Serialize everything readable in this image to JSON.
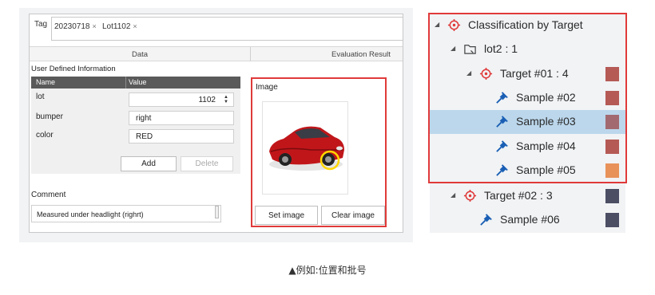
{
  "editor": {
    "tag_label": "Tag",
    "tags": [
      {
        "label": "20230718"
      },
      {
        "label": "Lot1102"
      }
    ],
    "remove_glyph": "×",
    "columns": {
      "data": "Data",
      "evaluation": "Evaluation Result"
    },
    "user_defined": {
      "title": "User Defined Information",
      "header_name": "Name",
      "header_value": "Value",
      "rows": [
        {
          "name": "lot",
          "value": "1102"
        },
        {
          "name": "bumper",
          "value": "right"
        },
        {
          "name": "color",
          "value": "RED"
        }
      ],
      "add_label": "Add",
      "delete_label": "Delete"
    },
    "comment": {
      "label": "Comment",
      "value": "Measured under headlight (righrt)"
    },
    "image": {
      "title": "Image",
      "set_label": "Set image",
      "clear_label": "Clear image"
    }
  },
  "tree": {
    "root": {
      "label": "Classification by Target",
      "icon": "target-icon"
    },
    "lot": {
      "label": "lot2 : 1",
      "icon": "folder-icon"
    },
    "target1": {
      "label": "Target #01 : 4",
      "icon": "target-icon",
      "color": "#b55a55"
    },
    "samples1": [
      {
        "label": "Sample #02",
        "color": "#b55a55"
      },
      {
        "label": "Sample #03",
        "color": "#a26a70",
        "selected": true
      },
      {
        "label": "Sample #04",
        "color": "#b55a55"
      },
      {
        "label": "Sample #05",
        "color": "#e8925a"
      }
    ],
    "target2": {
      "label": "Target #02 : 3",
      "icon": "target-icon",
      "color": "#4c4e64"
    },
    "samples2": [
      {
        "label": "Sample #06",
        "color": "#4c4e64"
      }
    ],
    "sample_icon": "pin-icon",
    "accent_color": "#e03a3a",
    "icon_color": "#1a5fb4"
  },
  "caption": "▲例如:位置和批号"
}
